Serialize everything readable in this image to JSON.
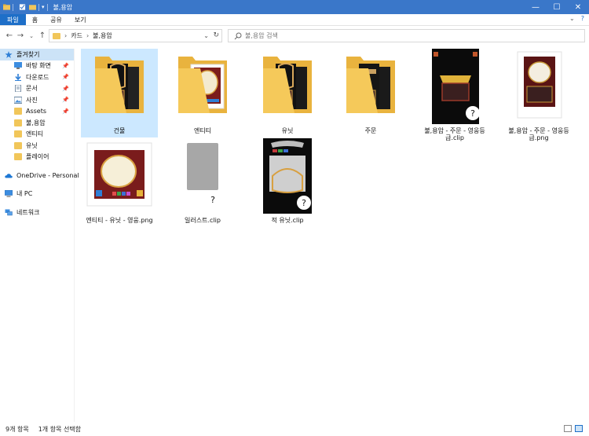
{
  "window": {
    "title": "불,용암"
  },
  "ribbon": {
    "tabs": [
      "파일",
      "홈",
      "공유",
      "보기"
    ]
  },
  "address": {
    "crumbs": [
      "카드",
      "불,용암"
    ]
  },
  "search": {
    "placeholder": "불,용암 검색"
  },
  "sidebar": {
    "quick_access": "즐겨찾기",
    "items": [
      "바탕 화면",
      "다운로드",
      "문서",
      "사진",
      "Assets",
      "불,용암",
      "엔티티",
      "유닛",
      "플레이어"
    ],
    "onedrive": "OneDrive - Personal",
    "pc": "내 PC",
    "network": "네트워크"
  },
  "files": [
    {
      "name": "건물",
      "type": "folder",
      "selected": true
    },
    {
      "name": "엔티티",
      "type": "folder"
    },
    {
      "name": "유닛",
      "type": "folder"
    },
    {
      "name": "주문",
      "type": "folder"
    },
    {
      "name": "불,용암 - 주문 - 영웅등급.clip",
      "type": "clip"
    },
    {
      "name": "불,용암 - 주문 - 영웅등급.png",
      "type": "png"
    },
    {
      "name": "엔티티 - 유닛 - 영웅.png",
      "type": "png"
    },
    {
      "name": "일러스트.clip",
      "type": "clip"
    },
    {
      "name": "적 유닛.clip",
      "type": "clip"
    }
  ],
  "status": {
    "count": "9개 항목",
    "selected": "1개 항목 선택함"
  },
  "colors": {
    "titlebar": "#3a77c9",
    "accent": "#1e6fc8",
    "selection": "#cce8ff",
    "folder": "#f1c65a"
  }
}
